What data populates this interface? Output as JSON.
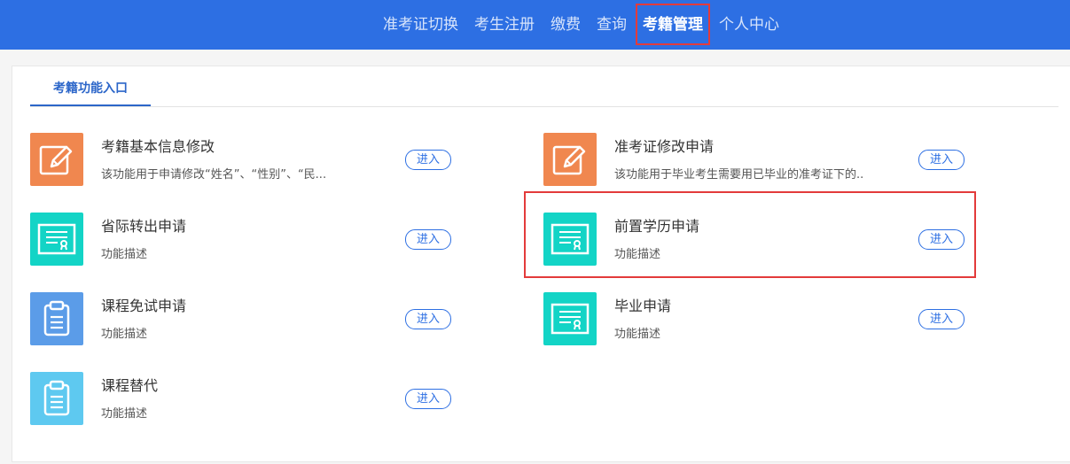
{
  "nav": {
    "items": [
      "准考证切换",
      "考生注册",
      "缴费",
      "查询",
      "考籍管理",
      "个人中心"
    ],
    "active_index": 4
  },
  "panel": {
    "tab_label": "考籍功能入口"
  },
  "colors": {
    "topbar": "#2d6fe3",
    "accent_blue": "#2d6fe3",
    "highlight_red": "#e33b3b",
    "icon_orange": "#f0874f",
    "icon_teal": "#13d4c6",
    "icon_blue": "#5b9ce8",
    "icon_light_blue": "#5ec9f0"
  },
  "items": [
    {
      "title": "考籍基本信息修改",
      "desc": "该功能用于申请修改“姓名”、“性别”、“民...",
      "button": "进入",
      "icon": "pencil-edit-icon"
    },
    {
      "title": "准考证修改申请",
      "desc": "该功能用于毕业考生需要用已毕业的准考证下的...",
      "button": "进入",
      "icon": "pencil-edit-icon"
    },
    {
      "title": "省际转出申请",
      "desc": "功能描述",
      "button": "进入",
      "icon": "certificate-icon"
    },
    {
      "title": "前置学历申请",
      "desc": "功能描述",
      "button": "进入",
      "icon": "certificate-icon"
    },
    {
      "title": "课程免试申请",
      "desc": "功能描述",
      "button": "进入",
      "icon": "clipboard-icon"
    },
    {
      "title": "毕业申请",
      "desc": "功能描述",
      "button": "进入",
      "icon": "certificate-icon"
    },
    {
      "title": "课程替代",
      "desc": "功能描述",
      "button": "进入",
      "icon": "clipboard-icon"
    }
  ]
}
